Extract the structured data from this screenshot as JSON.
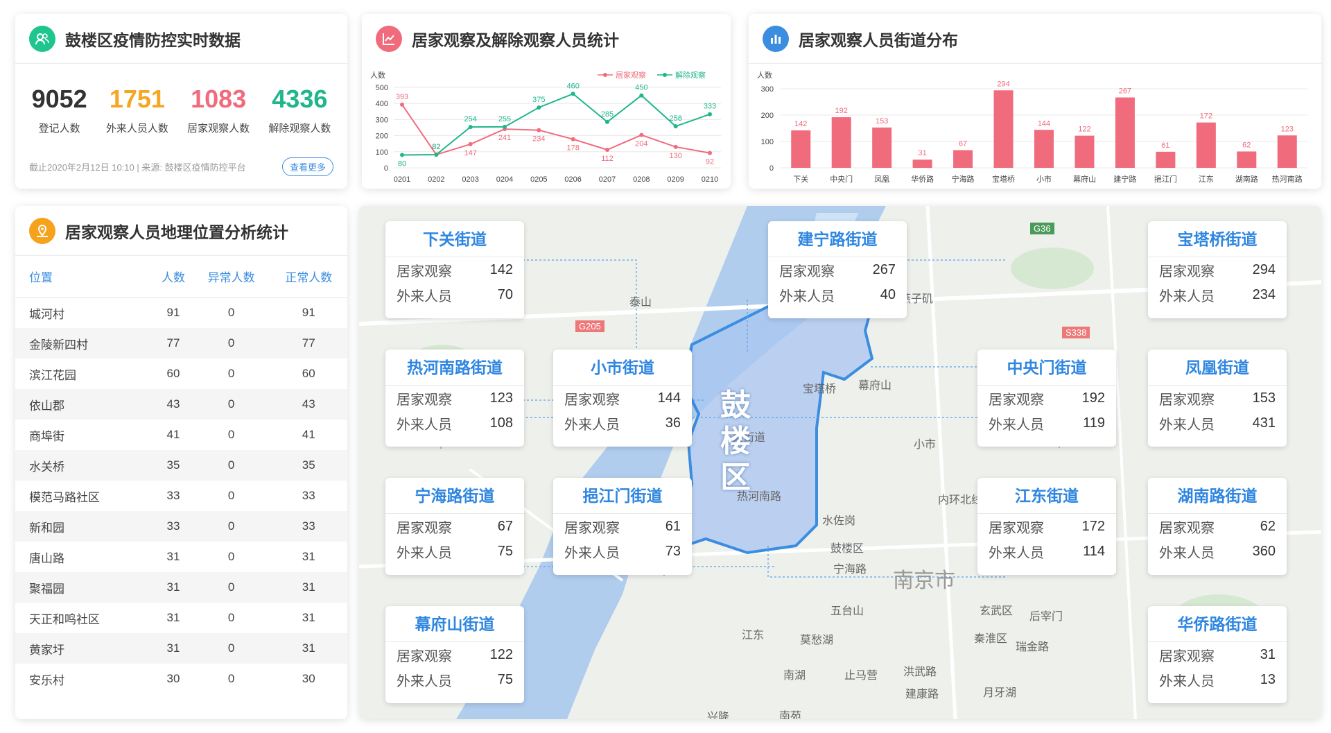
{
  "stats_panel": {
    "title": "鼓楼区疫情防控实时数据",
    "items": [
      {
        "value": "9052",
        "label": "登记人数",
        "color": "#333333"
      },
      {
        "value": "1751",
        "label": "外来人员人数",
        "color": "#f5a623"
      },
      {
        "value": "1083",
        "label": "居家观察人数",
        "color": "#f06b7c"
      },
      {
        "value": "4336",
        "label": "解除观察人数",
        "color": "#1fb68c"
      }
    ],
    "footnote": "截止2020年2月12日 10:10 | 来源: 鼓楼区疫情防控平台",
    "more_label": "查看更多"
  },
  "line_panel": {
    "title": "居家观察及解除观察人员统计"
  },
  "bar_panel": {
    "title": "居家观察人员街道分布"
  },
  "table_panel": {
    "title": "居家观察人员地理位置分析统计",
    "headers": [
      "位置",
      "人数",
      "异常人数",
      "正常人数"
    ],
    "rows": [
      [
        "城河村",
        "91",
        "0",
        "91"
      ],
      [
        "金陵新四村",
        "77",
        "0",
        "77"
      ],
      [
        "滨江花园",
        "60",
        "0",
        "60"
      ],
      [
        "依山郡",
        "43",
        "0",
        "43"
      ],
      [
        "商埠街",
        "41",
        "0",
        "41"
      ],
      [
        "水关桥",
        "35",
        "0",
        "35"
      ],
      [
        "模范马路社区",
        "33",
        "0",
        "33"
      ],
      [
        "新和园",
        "33",
        "0",
        "33"
      ],
      [
        "唐山路",
        "31",
        "0",
        "31"
      ],
      [
        "聚福园",
        "31",
        "0",
        "31"
      ],
      [
        "天正和鸣社区",
        "31",
        "0",
        "31"
      ],
      [
        "黄家圩",
        "31",
        "0",
        "31"
      ],
      [
        "安乐村",
        "30",
        "0",
        "30"
      ]
    ]
  },
  "map": {
    "district_label": "鼓楼区",
    "row_labels": {
      "observe": "居家观察",
      "outside": "外来人员"
    },
    "streets": [
      {
        "name": "下关街道",
        "observe": "142",
        "outside": "70"
      },
      {
        "name": "建宁路街道",
        "observe": "267",
        "outside": "40"
      },
      {
        "name": "宝塔桥街道",
        "observe": "294",
        "outside": "234"
      },
      {
        "name": "热河南路街道",
        "observe": "123",
        "outside": "108"
      },
      {
        "name": "小市街道",
        "observe": "144",
        "outside": "36"
      },
      {
        "name": "中央门街道",
        "observe": "192",
        "outside": "119"
      },
      {
        "name": "凤凰街道",
        "observe": "153",
        "outside": "431"
      },
      {
        "name": "宁海路街道",
        "observe": "67",
        "outside": "75"
      },
      {
        "name": "挹江门街道",
        "observe": "61",
        "outside": "73"
      },
      {
        "name": "江东街道",
        "observe": "172",
        "outside": "114"
      },
      {
        "name": "湖南路街道",
        "observe": "62",
        "outside": "360"
      },
      {
        "name": "幕府山街道",
        "observe": "122",
        "outside": "75"
      },
      {
        "name": "华侨路街道",
        "observe": "31",
        "outside": "13"
      }
    ],
    "place_labels": [
      "宝塔桥",
      "幕府山",
      "小市",
      "下关街道",
      "热河南路",
      "水佐岗",
      "鼓楼区",
      "宁海路",
      "五台山",
      "江东",
      "莫愁湖",
      "南京市",
      "燕子矶",
      "泰山",
      "内环北线",
      "玄武区",
      "秦淮区",
      "瑞金路",
      "后宰门",
      "南湖",
      "止马营",
      "建康路",
      "洪武路",
      "月牙湖",
      "兴隆",
      "南苑",
      "G205",
      "G36",
      "S338"
    ]
  },
  "chart_data": [
    {
      "type": "line",
      "ylabel": "人数",
      "categories": [
        "0201",
        "0202",
        "0203",
        "0204",
        "0205",
        "0206",
        "0207",
        "0208",
        "0209",
        "0210"
      ],
      "ylim": [
        0,
        500
      ],
      "yticks": [
        0,
        100,
        200,
        300,
        400,
        500
      ],
      "legend_position": "top-right",
      "series": [
        {
          "name": "居家观察",
          "color": "#f06b7c",
          "values": [
            393,
            82,
            147,
            241,
            234,
            178,
            112,
            204,
            130,
            92
          ]
        },
        {
          "name": "解除观察",
          "color": "#1fb68c",
          "values": [
            80,
            82,
            254,
            255,
            375,
            460,
            285,
            450,
            258,
            333
          ]
        }
      ]
    },
    {
      "type": "bar",
      "ylabel": "人数",
      "categories": [
        "下关",
        "中央门",
        "凤凰",
        "华侨路",
        "宁海路",
        "宝塔桥",
        "小市",
        "幕府山",
        "建宁路",
        "挹江门",
        "江东",
        "湖南路",
        "热河南路"
      ],
      "values": [
        142,
        192,
        153,
        31,
        67,
        294,
        144,
        122,
        267,
        61,
        172,
        62,
        123
      ],
      "ylim": [
        0,
        300
      ],
      "yticks": [
        0,
        100,
        200,
        300
      ],
      "color": "#f06b7c"
    }
  ]
}
